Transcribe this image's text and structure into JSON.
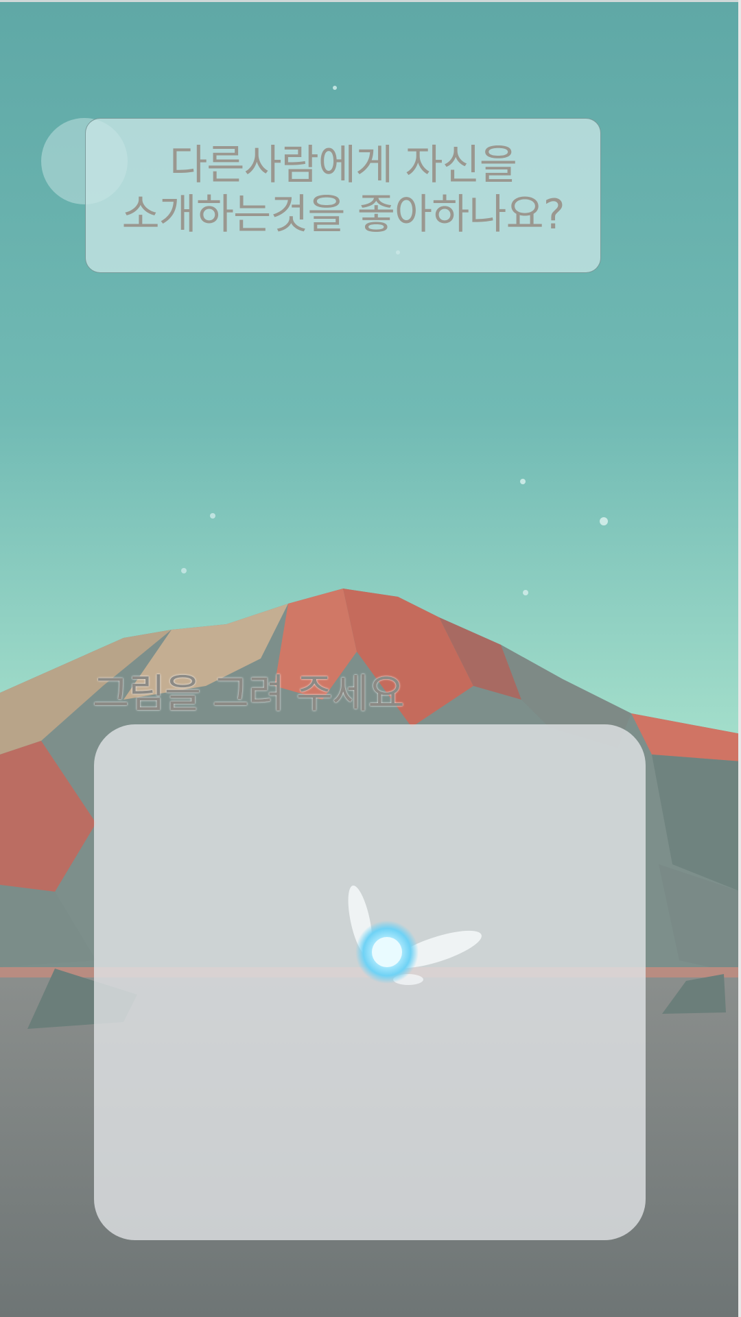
{
  "prompt": {
    "question_lines": [
      "다른사람에게 자신을",
      "소개하는것을 좋아하나요?"
    ]
  },
  "drawing": {
    "label": "그림을 그려 주세요"
  },
  "colors": {
    "sky_top": "#5fa8a6",
    "sky_bottom": "#9fdcc8",
    "mountain_red": "#c66a5e",
    "mountain_gray": "#7b8f8a",
    "ground": "#7a807f",
    "text_gray": "#9a978f"
  }
}
